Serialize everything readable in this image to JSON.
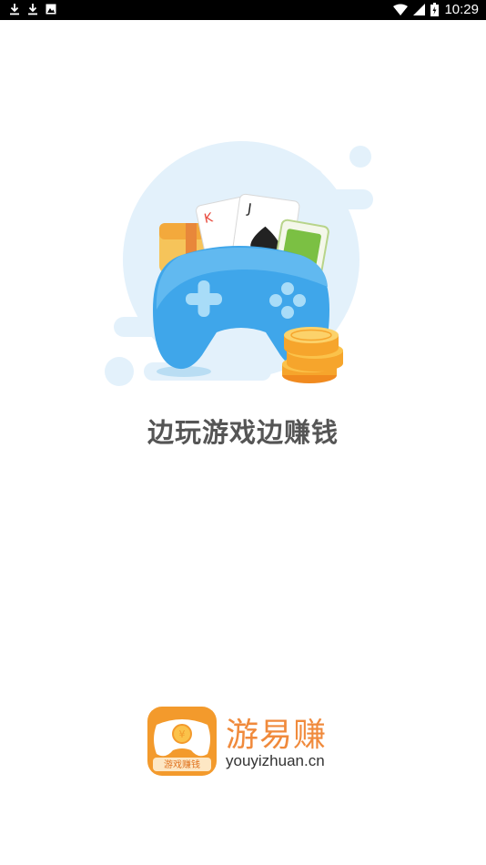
{
  "status_bar": {
    "time": "10:29",
    "left_icons": [
      "download-icon",
      "download-icon",
      "photo-icon"
    ],
    "right_icons": [
      "wifi-icon",
      "signal-icon",
      "battery-icon"
    ]
  },
  "splash": {
    "slogan": "边玩游戏边赚钱"
  },
  "brand": {
    "icon_label": "游戏赚钱",
    "name": "游易赚",
    "domain": "youyizhuan.cn",
    "accent_color": "#f08a3c"
  }
}
